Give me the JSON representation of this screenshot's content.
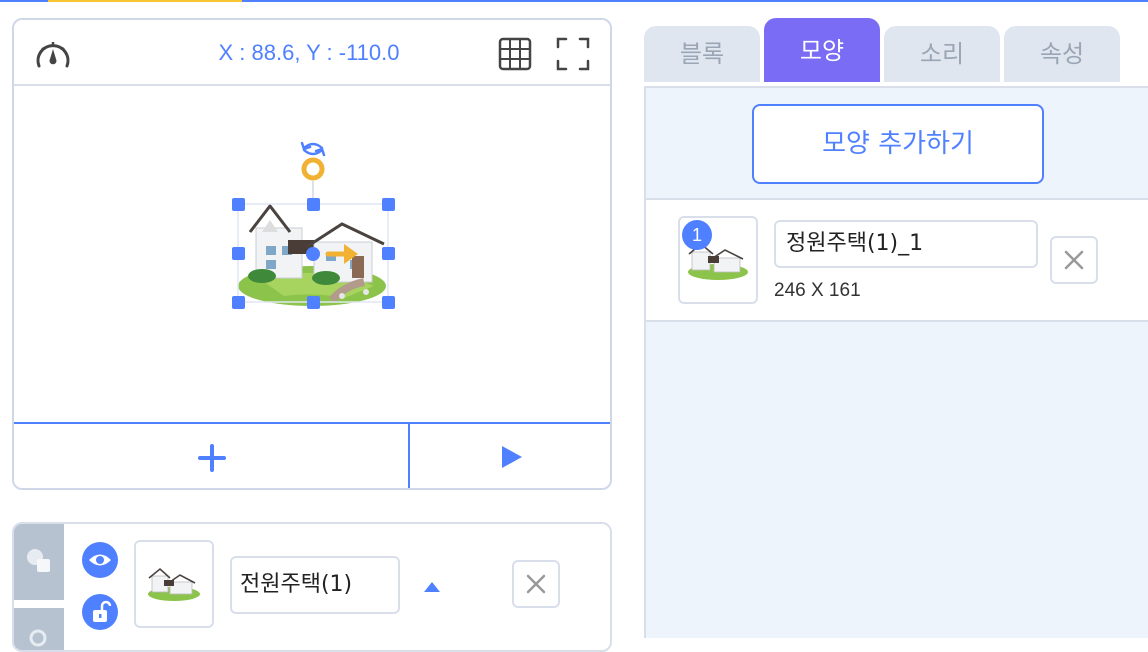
{
  "stage": {
    "coords": "X : 88.6, Y : -110.0",
    "icons": [
      "speed-gauge-icon",
      "grid-icon",
      "fullscreen-icon",
      "plus-icon",
      "play-icon",
      "rotate-icon"
    ]
  },
  "object": {
    "name": "전원주택(1)",
    "icons": [
      "eye-icon",
      "unlock-icon",
      "up-arrow-icon",
      "close-icon"
    ]
  },
  "tabs": [
    {
      "label": "블록",
      "active": false
    },
    {
      "label": "모양",
      "active": true
    },
    {
      "label": "소리",
      "active": false
    },
    {
      "label": "속성",
      "active": false
    }
  ],
  "shapes": {
    "add_label": "모양 추가하기",
    "items": [
      {
        "index": "1",
        "name": "정원주택(1)_1",
        "size": "246 X 161"
      }
    ]
  },
  "colors": {
    "accent": "#4f80ff",
    "active_tab": "#7a6cf5",
    "handle": "#4f80ff",
    "pivot": "#f1b233",
    "panel_bg": "#eef4fb"
  }
}
